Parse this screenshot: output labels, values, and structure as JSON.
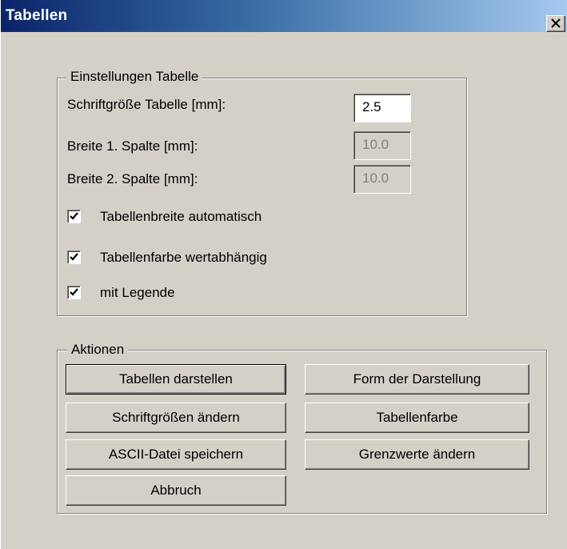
{
  "window": {
    "title": "Tabellen"
  },
  "settings": {
    "legend": "Einstellungen Tabelle",
    "font_size_label": "Schriftgröße Tabelle [mm]:",
    "font_size_value": "2.5",
    "col1_width_label": "Breite 1. Spalte [mm]:",
    "col1_width_value": "10.0",
    "col2_width_label": "Breite 2. Spalte [mm]:",
    "col2_width_value": "10.0",
    "checkboxes": [
      {
        "label": "Tabellenbreite automatisch",
        "checked": true
      },
      {
        "label": "Tabellenfarbe wertabhängig",
        "checked": true
      },
      {
        "label": "mit Legende",
        "checked": true
      }
    ]
  },
  "actions": {
    "legend": "Aktionen",
    "show_tables": "Tabellen darstellen",
    "display_form": "Form der Darstellung",
    "change_font_sizes": "Schriftgrößen ändern",
    "table_color": "Tabellenfarbe",
    "save_ascii": "ASCII-Datei speichern",
    "change_limits": "Grenzwerte ändern",
    "cancel": "Abbruch"
  },
  "colors": {
    "dialog_background": "#d4d0c8",
    "title_gradient_start": "#0a246a",
    "title_gradient_end": "#a6caf0",
    "disabled_text": "#808080"
  },
  "icons": {
    "close": "close-x-icon",
    "check": "checkmark-icon"
  }
}
